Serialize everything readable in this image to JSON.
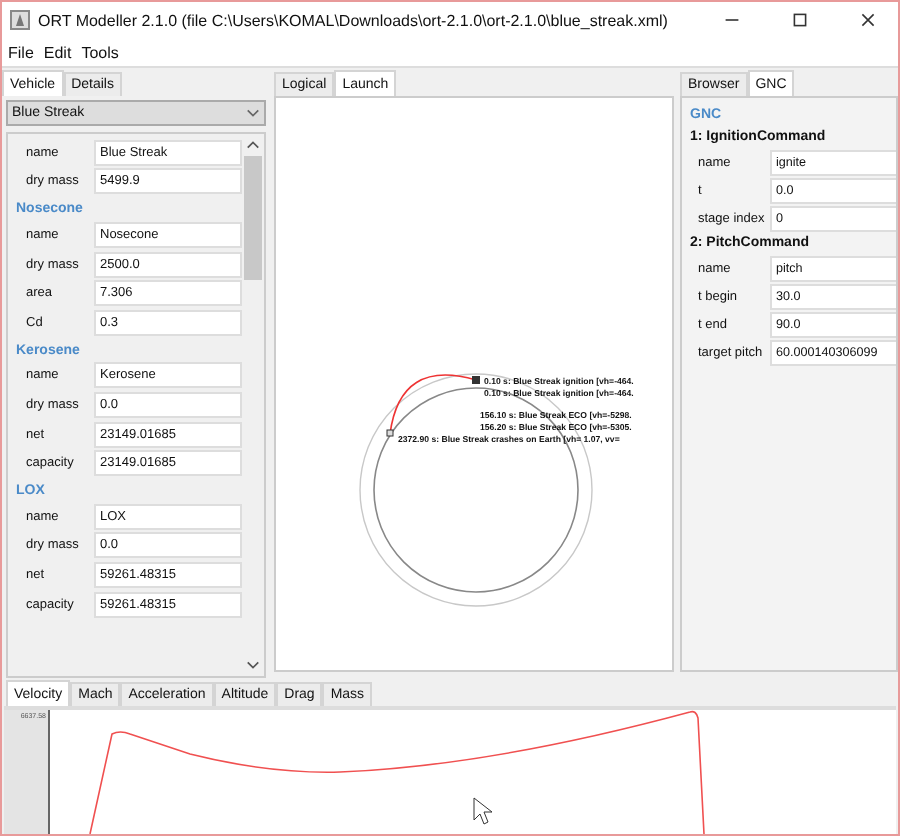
{
  "window": {
    "title": "ORT Modeller 2.1.0 (file C:\\Users\\KOMAL\\Downloads\\ort-2.1.0\\ort-2.1.0\\blue_streak.xml)"
  },
  "menu": [
    "File",
    "Edit",
    "Tools"
  ],
  "left_panel": {
    "tabs": [
      {
        "label": "Vehicle",
        "selected": true
      },
      {
        "label": "Details",
        "selected": false
      }
    ],
    "vehicle_select": "Blue Streak",
    "sections": [
      {
        "fields": [
          {
            "label": "name",
            "value": "Blue Streak"
          },
          {
            "label": "dry mass",
            "value": "5499.9"
          }
        ]
      },
      {
        "heading": "Nosecone",
        "fields": [
          {
            "label": "name",
            "value": "Nosecone"
          },
          {
            "label": "dry mass",
            "value": "2500.0"
          },
          {
            "label": "area",
            "value": "7.306"
          },
          {
            "label": "Cd",
            "value": "0.3"
          }
        ]
      },
      {
        "heading": "Kerosene",
        "fields": [
          {
            "label": "name",
            "value": "Kerosene"
          },
          {
            "label": "dry mass",
            "value": "0.0"
          },
          {
            "label": "net",
            "value": "23149.01685"
          },
          {
            "label": "capacity",
            "value": "23149.01685"
          }
        ]
      },
      {
        "heading": "LOX",
        "fields": [
          {
            "label": "name",
            "value": "LOX"
          },
          {
            "label": "dry mass",
            "value": "0.0"
          },
          {
            "label": "net",
            "value": "59261.48315"
          },
          {
            "label": "capacity",
            "value": "59261.48315"
          }
        ]
      }
    ]
  },
  "center_panel": {
    "tabs": [
      {
        "label": "Logical",
        "selected": false
      },
      {
        "label": "Launch",
        "selected": true
      }
    ],
    "events": [
      "0.10 s: Blue Streak ignition [vh=-464.",
      "0.10 s: Blue Streak ignition [vh=-464.",
      "156.10 s: Blue Streak ECO [vh=-5298.",
      "156.20 s: Blue Streak ECO [vh=-5305.",
      "2372.90 s: Blue Streak crashes on Earth [vh= 1.07, vv="
    ]
  },
  "right_panel": {
    "tabs": [
      {
        "label": "Browser",
        "selected": false
      },
      {
        "label": "GNC",
        "selected": true
      }
    ],
    "heading": "GNC",
    "commands": [
      {
        "title": "1: IgnitionCommand",
        "fields": [
          {
            "label": "name",
            "value": "ignite"
          },
          {
            "label": "t",
            "value": "0.0"
          },
          {
            "label": "stage index",
            "value": "0"
          }
        ]
      },
      {
        "title": "2: PitchCommand",
        "fields": [
          {
            "label": "name",
            "value": "pitch"
          },
          {
            "label": "t begin",
            "value": "30.0"
          },
          {
            "label": "t end",
            "value": "90.0"
          },
          {
            "label": "target pitch",
            "value": "60.000140306099"
          }
        ]
      }
    ]
  },
  "plots": {
    "tabs": [
      {
        "label": "Velocity",
        "selected": true
      },
      {
        "label": "Mach",
        "selected": false
      },
      {
        "label": "Acceleration",
        "selected": false
      },
      {
        "label": "Altitude",
        "selected": false
      },
      {
        "label": "Drag",
        "selected": false
      },
      {
        "label": "Mass",
        "selected": false
      }
    ],
    "y_max_label": "6637.58"
  }
}
